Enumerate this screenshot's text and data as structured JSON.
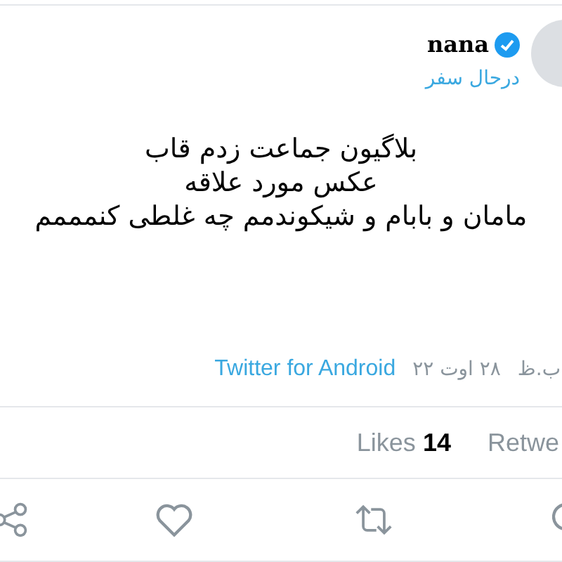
{
  "author": {
    "name": "nana",
    "verified": true,
    "status": "درحال سفر"
  },
  "tweet": {
    "lines": [
      "بلاگیون جماعت زدم قاب",
      "عکس مورد علاقه",
      "مامان و بابام و شیکوندمم چه غلطی کنمممم"
    ]
  },
  "meta": {
    "source": "Twitter for Android",
    "date": "۲۸ اوت ۲۲",
    "time": "ب.ظ"
  },
  "stats": [
    {
      "label": "Retwe"
    },
    {
      "label": "Likes",
      "count": "14"
    }
  ],
  "actions": [
    {
      "kind": "share"
    },
    {
      "kind": "like"
    },
    {
      "kind": "retweet"
    },
    {
      "kind": "reply"
    }
  ]
}
